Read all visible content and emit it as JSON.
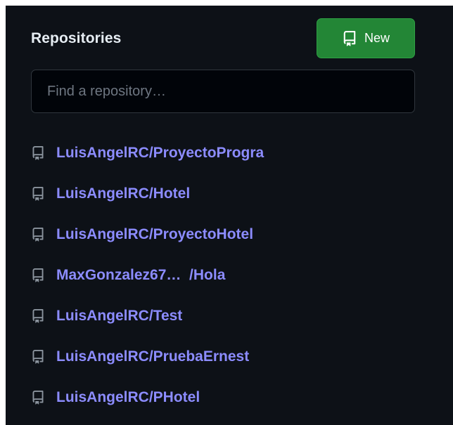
{
  "header": {
    "title": "Repositories",
    "new_button_label": "New"
  },
  "search": {
    "placeholder": "Find a repository…",
    "value": ""
  },
  "repositories": [
    {
      "name": "LuisAngelRC/ProyectoProgra"
    },
    {
      "name": "LuisAngelRC/Hotel"
    },
    {
      "name": "LuisAngelRC/ProyectoHotel"
    },
    {
      "name": "MaxGonzalez67…  /Hola"
    },
    {
      "name": "LuisAngelRC/Test"
    },
    {
      "name": "LuisAngelRC/PruebaErnest"
    },
    {
      "name": "LuisAngelRC/PHotel"
    }
  ],
  "icons": {
    "new_button": "repo-icon",
    "repo_item": "repo-icon"
  },
  "colors": {
    "background": "#0d1117",
    "accent_button": "#238636",
    "link": "#8c8cff",
    "icon": "#8b949e"
  }
}
